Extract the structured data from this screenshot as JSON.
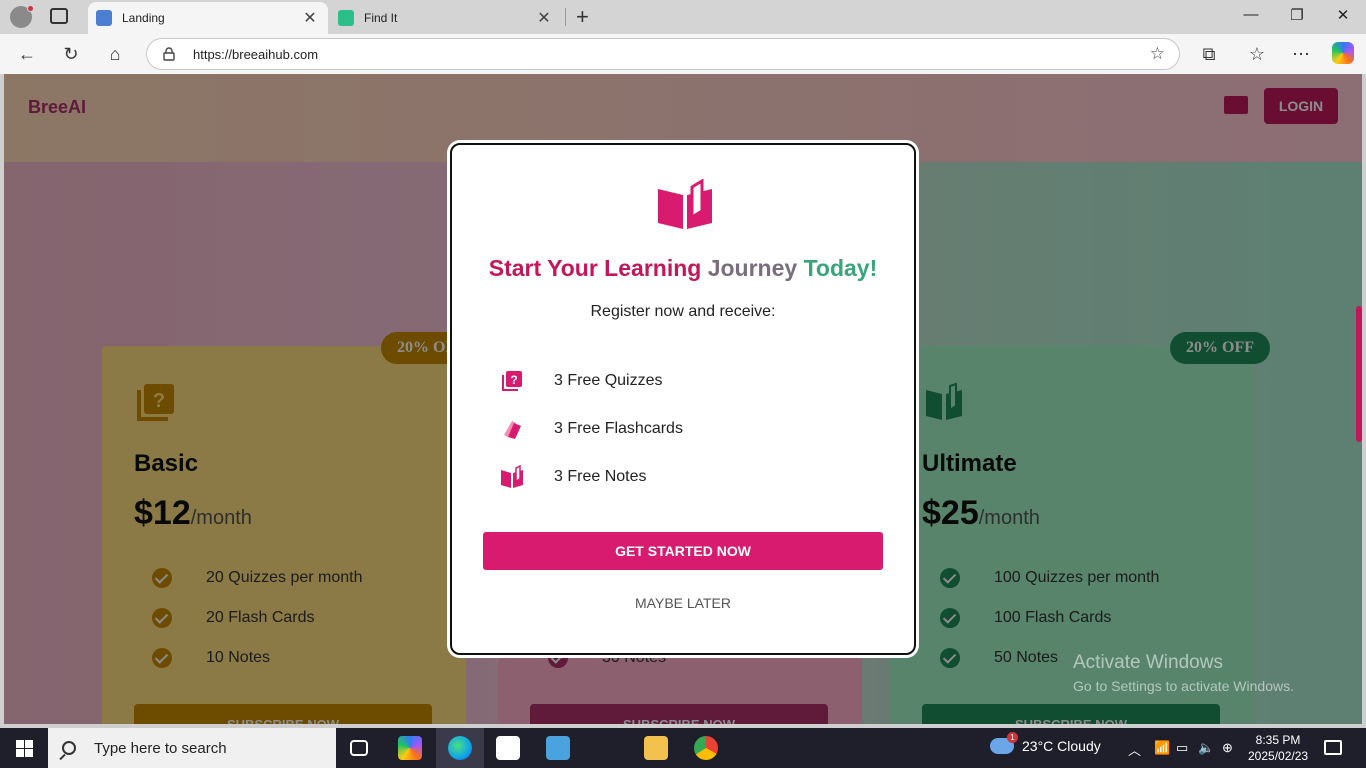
{
  "browser": {
    "tabs": [
      {
        "label": "Landing",
        "active": true
      },
      {
        "label": "Find It",
        "active": false
      }
    ],
    "url": "https://breeaihub.com"
  },
  "site": {
    "brand": "BreeAI",
    "login_label": "LOGIN"
  },
  "plans": [
    {
      "name": "Basic",
      "price": "$12",
      "period": "/month",
      "badge": "20% OFF",
      "features": [
        "20 Quizzes per month",
        "20 Flash Cards",
        "10 Notes"
      ],
      "cta": "SUBSCRIBE NOW",
      "color": "#c78a00"
    },
    {
      "name": "",
      "price": "",
      "period": "",
      "badge": "",
      "features": [
        "30 Notes"
      ],
      "cta": "SUBSCRIBE NOW",
      "color": "#b0306b"
    },
    {
      "name": "Ultimate",
      "price": "$25",
      "period": "/month",
      "badge": "20% OFF",
      "features": [
        "100 Quizzes per month",
        "100 Flash Cards",
        "50 Notes"
      ],
      "cta": "SUBSCRIBE NOW",
      "color": "#1e8c5a"
    }
  ],
  "modal": {
    "title_part1": "Start Your Learning",
    "title_part2": "Journey",
    "title_part3": "Today!",
    "subtitle": "Register now and receive:",
    "benefits": [
      {
        "icon": "quiz-icon",
        "label": "3 Free Quizzes"
      },
      {
        "icon": "flashcards-icon",
        "label": "3 Free Flashcards"
      },
      {
        "icon": "notes-icon",
        "label": "3 Free Notes"
      }
    ],
    "primary_button": "GET STARTED NOW",
    "secondary_button": "MAYBE LATER",
    "accent": "#d81b6e"
  },
  "watermark": {
    "line1": "Activate Windows",
    "line2": "Go to Settings to activate Windows."
  },
  "taskbar": {
    "search_placeholder": "Type here to search",
    "weather": "23°C  Cloudy",
    "weather_badge": "1",
    "time": "8:35 PM",
    "date": "2025/02/23"
  }
}
